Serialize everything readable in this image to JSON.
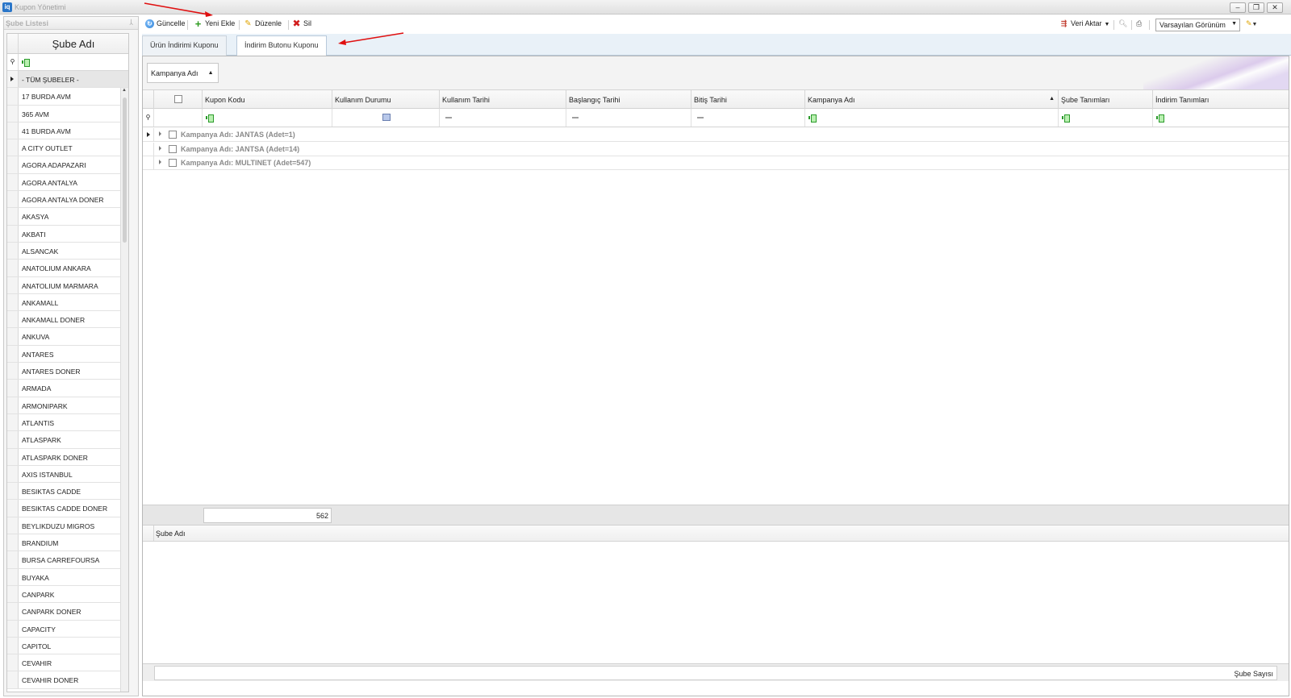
{
  "window": {
    "title": "Kupon Yönetimi",
    "icon_text": "iq",
    "controls": {
      "minimize": "–",
      "restore": "❐",
      "close": "✕"
    }
  },
  "left_panel": {
    "title": "Şube Listesi",
    "column_header": "Şube Adı",
    "branches": [
      "- TÜM ŞUBELER -",
      "17 BURDA AVM",
      "365 AVM",
      "41 BURDA AVM",
      "A CITY OUTLET",
      "AGORA ADAPAZARI",
      "AGORA ANTALYA",
      "AGORA ANTALYA DONER",
      "AKASYA",
      "AKBATI",
      "ALSANCAK",
      "ANATOLIUM ANKARA",
      "ANATOLIUM MARMARA",
      "ANKAMALL",
      "ANKAMALL DONER",
      "ANKUVA",
      "ANTARES",
      "ANTARES DONER",
      "ARMADA",
      "ARMONIPARK",
      "ATLANTIS",
      "ATLASPARK",
      "ATLASPARK DONER",
      "AXIS ISTANBUL",
      "BESIKTAS CADDE",
      "BESIKTAS CADDE DONER",
      "BEYLIKDUZU MIGROS",
      "BRANDIUM",
      "BURSA CARREFOURSA",
      "BUYAKA",
      "CANPARK",
      "CANPARK DONER",
      "CAPACITY",
      "CAPITOL",
      "CEVAHIR",
      "CEVAHIR DONER"
    ]
  },
  "toolbar": {
    "refresh": "Güncelle",
    "add_new": "Yeni Ekle",
    "edit": "Düzenle",
    "delete": "Sil",
    "export": "Veri Aktar",
    "view_selected": "Varsayılan Görünüm"
  },
  "tabs": [
    {
      "label": "Ürün İndirimi Kuponu",
      "active": false
    },
    {
      "label": "İndirim Butonu Kuponu",
      "active": true
    }
  ],
  "grid": {
    "group_by": "Kampanya Adı",
    "columns": [
      "Kupon Kodu",
      "Kullanım Durumu",
      "Kullanım Tarihi",
      "Başlangıç Tarihi",
      "Bitiş Tarihi",
      "Kampanya Adı",
      "Şube Tanımları",
      "İndirim Tanımları"
    ],
    "group_rows": [
      "Kampanya Adı: JANTAS (Adet=1)",
      "Kampanya Adı: JANTSA (Adet=14)",
      "Kampanya Adı: MULTINET (Adet=547)"
    ],
    "footer_count": "562"
  },
  "detail_grid": {
    "column": "Şube Adı",
    "footer": "Şube Sayısı"
  },
  "colors": {
    "annotation_arrow": "#e01010",
    "tab_strip": "#e9f1f8",
    "accent_blue": "#2a76c9"
  }
}
